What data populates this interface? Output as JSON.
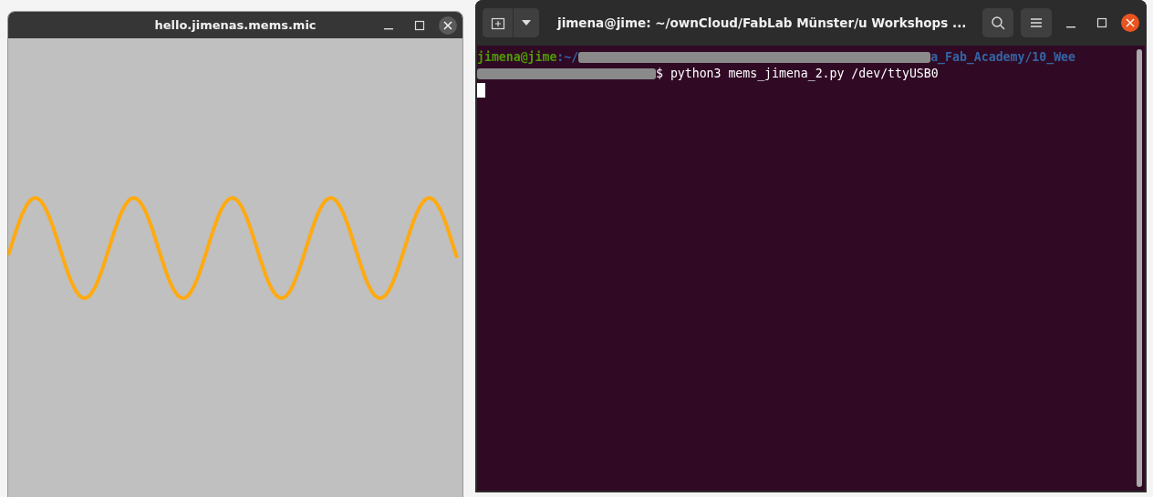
{
  "plot_window": {
    "title": "hello.jimenas.mems.mic"
  },
  "terminal_window": {
    "title": "jimena@jime: ~/ownCloud/FabLab Münster/u Workshops ...",
    "prompt_user": "jimena@jime",
    "prompt_path_start": ":~/",
    "prompt_path_end": "a_Fab_Academy/10_Wee",
    "command": "$ python3 mems_jimena_2.py /dev/ttyUSB0"
  }
}
